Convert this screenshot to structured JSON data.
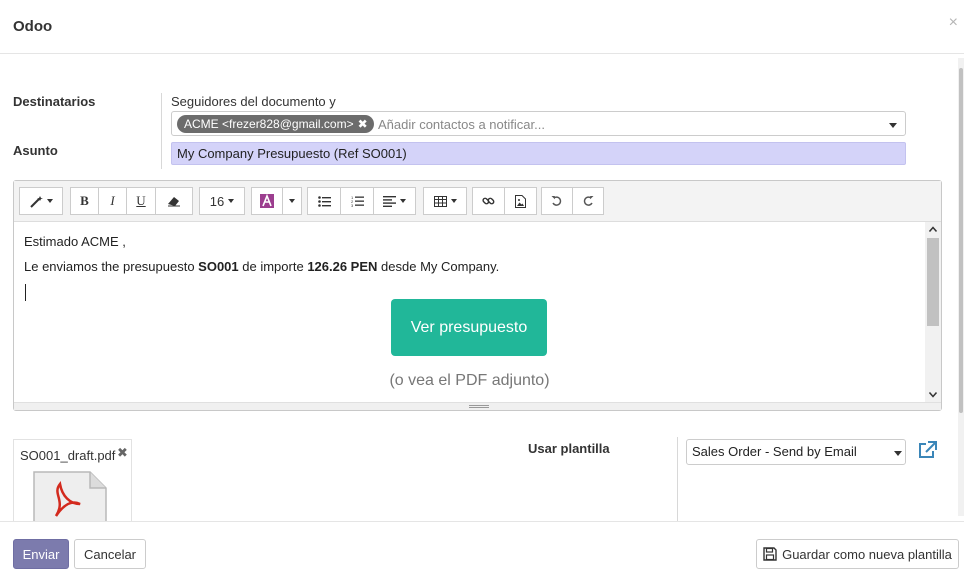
{
  "dialog": {
    "title": "Odoo",
    "close_symbol": "×"
  },
  "recipients": {
    "label": "Destinatarios",
    "followers_text": "Seguidores del documento y",
    "tag_text": "ACME <frezer828@gmail.com>",
    "tag_remove_symbol": "✖",
    "placeholder": "Añadir contactos a notificar..."
  },
  "subject": {
    "label": "Asunto",
    "value": "My Company Presupuesto (Ref SO001)"
  },
  "toolbar": {
    "font_size": "16",
    "bold": "B",
    "italic": "I",
    "underline": "U"
  },
  "body": {
    "greeting": "Estimado ACME ,",
    "line_prefix": "Le enviamos the presupuesto ",
    "order_ref": "SO001",
    "line_middle": " de importe ",
    "amount": "126.26 PEN",
    "line_suffix": " desde My Company.",
    "view_button": "Ver presupuesto",
    "pdf_note": "(o vea el PDF adjunto)"
  },
  "attachment": {
    "filename": "SO001_draft.pdf",
    "remove_symbol": "✖"
  },
  "template": {
    "label": "Usar plantilla",
    "selected": "Sales Order - Send by Email"
  },
  "footer": {
    "send_label": "Enviar",
    "cancel_label": "Cancelar",
    "save_template_label": "Guardar como nueva plantilla"
  },
  "colors": {
    "send_button": "#7c7bad",
    "view_button": "#21b799",
    "subject_background": "#d4d3f9",
    "tag_background": "#6c6c6c"
  }
}
